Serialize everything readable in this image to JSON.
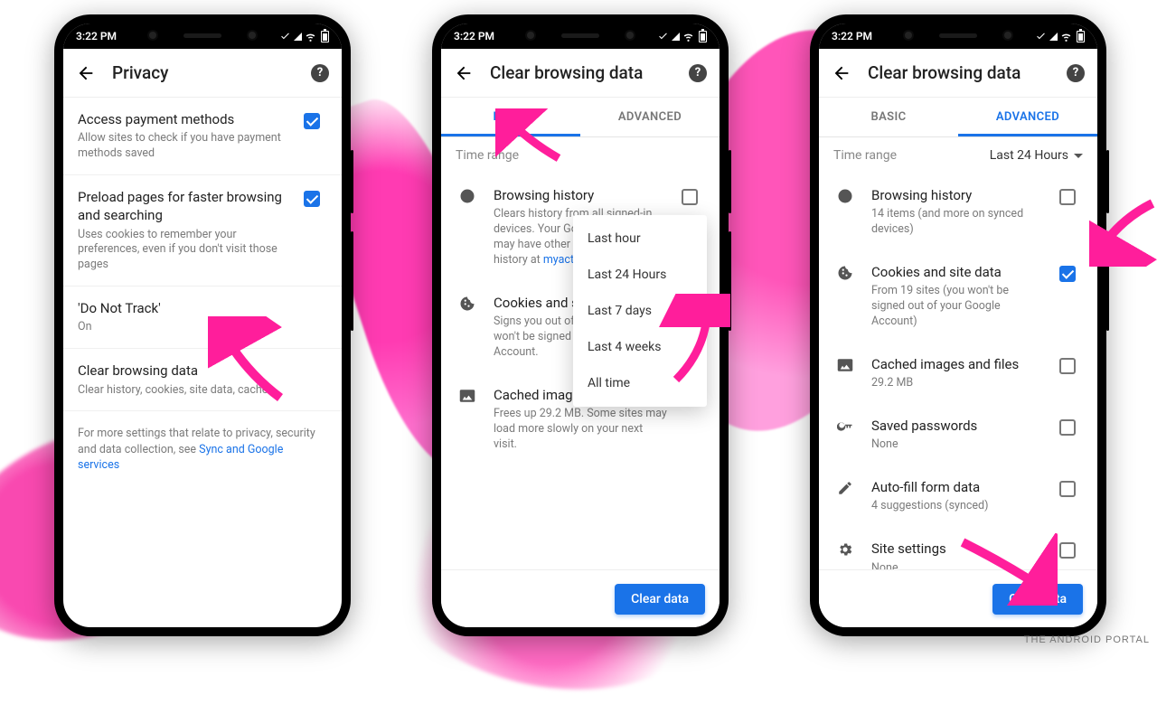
{
  "watermark": "THE ANDROID PORTAL",
  "statusbar": {
    "time": "3:22 PM"
  },
  "p1": {
    "title": "Privacy",
    "rows": {
      "payment": {
        "title": "Access payment methods",
        "sub": "Allow sites to check if you have payment methods saved"
      },
      "preload": {
        "title": "Preload pages for faster browsing and searching",
        "sub": "Uses cookies to remember your preferences, even if you don't visit those pages"
      },
      "dnt": {
        "title": "'Do Not Track'",
        "sub": "On"
      },
      "clear": {
        "title": "Clear browsing data",
        "sub": "Clear history, cookies, site data, cache…"
      }
    },
    "foot_pre": "For more settings that relate to privacy, security and data collection, see ",
    "foot_link": "Sync and Google services"
  },
  "p2": {
    "title": "Clear browsing data",
    "tabs": {
      "basic": "BASIC",
      "advanced": "ADVANCED"
    },
    "time_label": "Time range",
    "popup": [
      "Last hour",
      "Last 24 Hours",
      "Last 7 days",
      "Last 4 weeks",
      "All time"
    ],
    "rows": {
      "history": {
        "title": "Browsing history",
        "sub": "Clears history from all signed-in devices. Your Google Account may have other forms of browsing history at ",
        "link": "myactivity.google.com"
      },
      "cookies": {
        "title": "Cookies and site data",
        "sub": "Signs you out of most sites. You won't be signed out of your Google Account."
      },
      "cache": {
        "title": "Cached images and files",
        "sub": "Frees up 29.2 MB. Some sites may load more slowly on your next visit."
      }
    },
    "action": "Clear data"
  },
  "p3": {
    "title": "Clear browsing data",
    "tabs": {
      "basic": "BASIC",
      "advanced": "ADVANCED"
    },
    "time_label": "Time range",
    "time_value": "Last 24 Hours",
    "rows": {
      "history": {
        "title": "Browsing history",
        "sub": "14 items (and more on synced devices)"
      },
      "cookies": {
        "title": "Cookies and site data",
        "sub": "From 19 sites (you won't be signed out of your Google Account)"
      },
      "cache": {
        "title": "Cached images and files",
        "sub": "29.2 MB"
      },
      "passwords": {
        "title": "Saved passwords",
        "sub": "None"
      },
      "autofill": {
        "title": "Auto-fill form data",
        "sub": "4 suggestions (synced)"
      },
      "site": {
        "title": "Site settings",
        "sub": "None"
      }
    },
    "action": "Clear data"
  }
}
